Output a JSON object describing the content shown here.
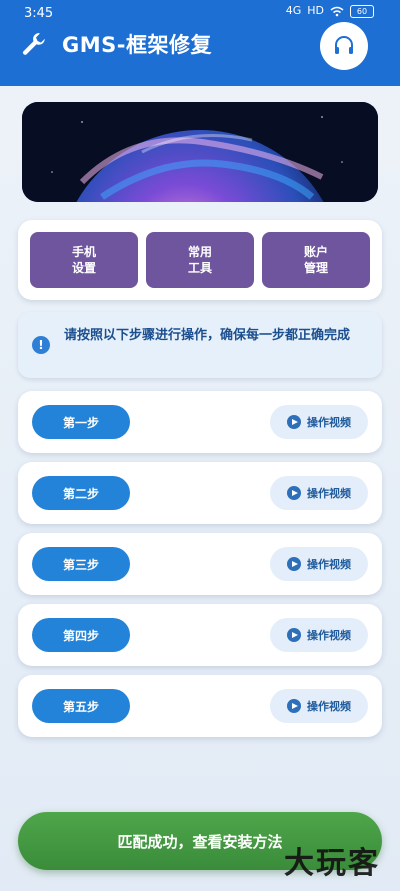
{
  "status_bar": {
    "time": "3:45",
    "signal_1": "4G",
    "signal_2": "HD",
    "battery": "60"
  },
  "header": {
    "title": "GMS-框架修复",
    "wrench_icon": "wrench-icon",
    "support_icon": "headset-icon",
    "background_color": "#1e6fd3"
  },
  "tools": [
    {
      "line1": "手机",
      "line2": "设置"
    },
    {
      "line1": "常用",
      "line2": "工具"
    },
    {
      "line1": "账户",
      "line2": "管理"
    }
  ],
  "notice": {
    "icon": "info-icon",
    "text": "请按照以下步骤进行操作，确保每一步都正确完成"
  },
  "steps": [
    {
      "label": "第一步",
      "video_label": "操作视频"
    },
    {
      "label": "第二步",
      "video_label": "操作视频"
    },
    {
      "label": "第三步",
      "video_label": "操作视频"
    },
    {
      "label": "第四步",
      "video_label": "操作视频"
    },
    {
      "label": "第五步",
      "video_label": "操作视频"
    }
  ],
  "bottom_button": {
    "label": "匹配成功，查看安装方法",
    "color": "#3f963e"
  },
  "watermark": "大玩客",
  "colors": {
    "step_button": "#2283d8",
    "tool_button": "#6e559e"
  }
}
